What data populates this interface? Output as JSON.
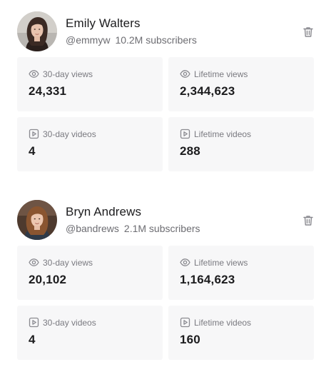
{
  "colors": {
    "card_background": "#f7f7f8",
    "text_primary": "#1c1c1e",
    "text_secondary": "#6d6d72",
    "icon_gray": "#8a8a90"
  },
  "creators": [
    {
      "name": "Emily Walters",
      "handle": "@emmyw",
      "subscribers": "10.2M subscribers",
      "actions": {
        "delete_icon": "trash-icon"
      },
      "stats": {
        "views_30d": {
          "label": "30-day views",
          "value": "24,331",
          "icon": "eye-icon"
        },
        "views_lifetime": {
          "label": "Lifetime views",
          "value": "2,344,623",
          "icon": "eye-icon"
        },
        "videos_30d": {
          "label": "30-day videos",
          "value": "4",
          "icon": "play-square-icon"
        },
        "videos_lifetime": {
          "label": "Lifetime videos",
          "value": "288",
          "icon": "play-square-icon"
        }
      }
    },
    {
      "name": "Bryn Andrews",
      "handle": "@bandrews",
      "subscribers": "2.1M subscribers",
      "actions": {
        "delete_icon": "trash-icon"
      },
      "stats": {
        "views_30d": {
          "label": "30-day views",
          "value": "20,102",
          "icon": "eye-icon"
        },
        "views_lifetime": {
          "label": "Lifetime views",
          "value": "1,164,623",
          "icon": "eye-icon"
        },
        "videos_30d": {
          "label": "30-day videos",
          "value": "4",
          "icon": "play-square-icon"
        },
        "videos_lifetime": {
          "label": "Lifetime videos",
          "value": "160",
          "icon": "play-square-icon"
        }
      }
    }
  ]
}
